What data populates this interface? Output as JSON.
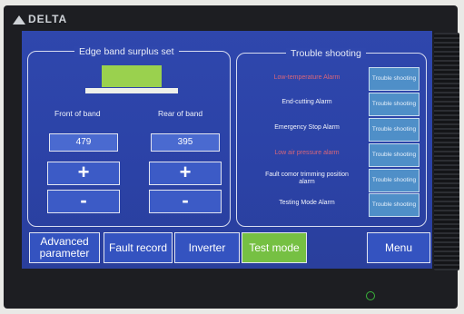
{
  "brand": "DELTA",
  "left_panel": {
    "title": "Edge band surplus set",
    "front_label": "Front of band",
    "rear_label": "Rear of band",
    "front_value": "479",
    "rear_value": "395",
    "plus": "+",
    "minus": "-"
  },
  "right_panel": {
    "title": "Trouble shooting",
    "alarms": [
      {
        "label": "Low-temperature Alarm",
        "button": "Trouble shooting"
      },
      {
        "label": "End-cutting Alarm",
        "button": "Trouble shooting"
      },
      {
        "label": "Emergency Stop Alarm",
        "button": "Trouble shooting"
      },
      {
        "label": "Low air pressure alarm",
        "button": "Trouble shooting"
      },
      {
        "label": "Fault comor trimming position alarm",
        "button": "Trouble shooting"
      },
      {
        "label": "Testing Mode Alarm",
        "button": "Trouble shooting"
      }
    ]
  },
  "bottom": {
    "advanced": "Advanced parameter",
    "fault": "Fault record",
    "inverter": "Inverter",
    "test": "Test mode",
    "menu": "Menu"
  },
  "colors": {
    "screen_bg": "#2f47ad",
    "accent_green": "#76c043",
    "alarm_red": "#d9667a",
    "ts_button": "#4f8fc8"
  }
}
